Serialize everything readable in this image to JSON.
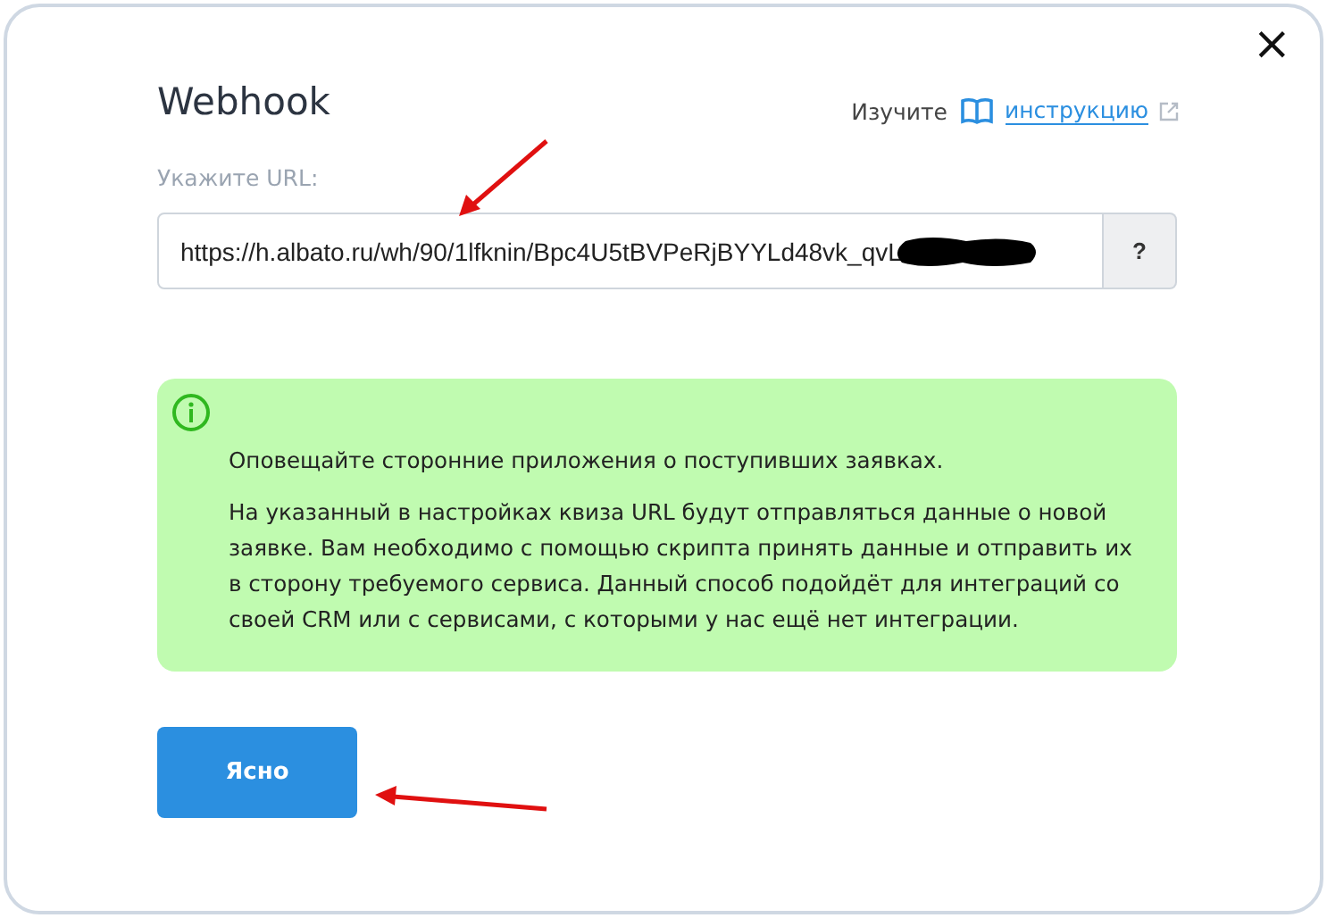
{
  "dialog": {
    "title": "Webhook",
    "close": "×"
  },
  "guide": {
    "prefix": "Изучите",
    "link": "инструкцию"
  },
  "url_field": {
    "label": "Укажите URL:",
    "value": "https://h.albato.ru/wh/90/1lfknin/Bpc4U5tBVPeRjBYYLd48vk_qvL",
    "help": "?"
  },
  "notice": {
    "paragraphs": [
      "Оповещайте сторонние приложения о поступивших заявках.",
      "На указанный в настройках квиза URL будут отправляться данные о новой заявке. Вам необходимо с помощью скрипта принять данные и отправить их в сторону требуемого сервиса. Данный способ подойдёт для интеграций со своей CRM или с сервисами, с которыми у нас ещё нет интеграции."
    ]
  },
  "buttons": [
    "Ясно"
  ]
}
